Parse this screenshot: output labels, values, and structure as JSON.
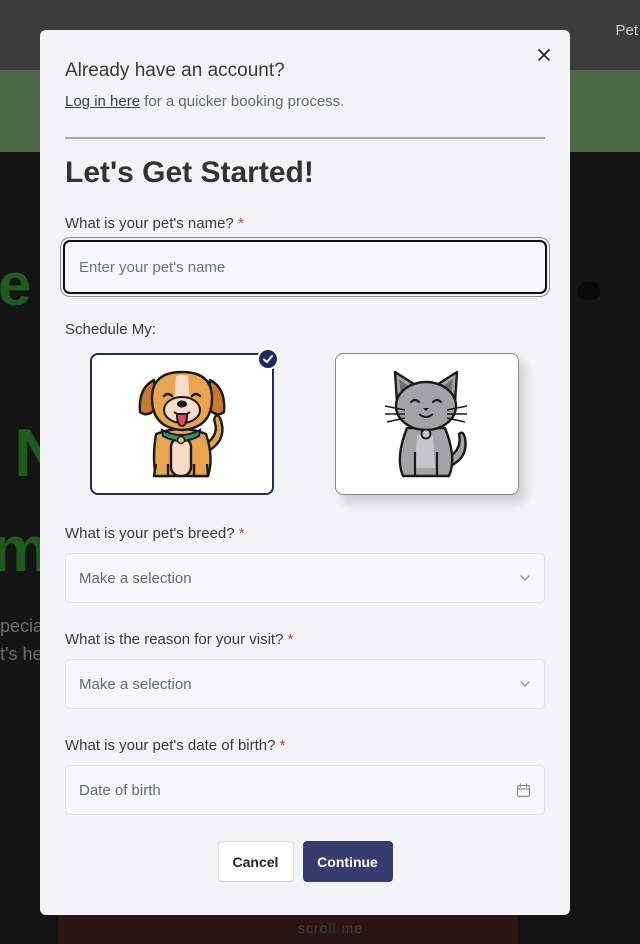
{
  "background": {
    "header_text": "Pet",
    "scroll_text": "scroll me",
    "hero_fragments": [
      "e",
      "N",
      "m"
    ],
    "hero_text_lines": [
      "pecia",
      "t's he"
    ]
  },
  "modal": {
    "account_title": "Already have an account?",
    "login_link": "Log in here",
    "login_suffix": " for a quicker booking process.",
    "title": "Let's Get Started!",
    "pet_name": {
      "label": "What is your pet's name?",
      "placeholder": "Enter your pet's name",
      "value": ""
    },
    "schedule_label": "Schedule My:",
    "pet_options": [
      {
        "name": "dog",
        "icon": "dog-icon",
        "selected": true
      },
      {
        "name": "cat",
        "icon": "cat-icon",
        "selected": false
      }
    ],
    "breed": {
      "label": "What is your pet's breed?",
      "value": "Make a selection"
    },
    "reason": {
      "label": "What is the reason for your visit?",
      "value": "Make a selection"
    },
    "dob": {
      "label": "What is your pet's date of birth?",
      "placeholder": "Date of birth"
    },
    "required_marker": "*",
    "buttons": {
      "cancel": "Cancel",
      "continue": "Continue"
    }
  },
  "colors": {
    "accent": "#363c6e",
    "selected_border": "#1f2d5c",
    "required": "#d23a3a",
    "link": "#2e3e6e"
  }
}
